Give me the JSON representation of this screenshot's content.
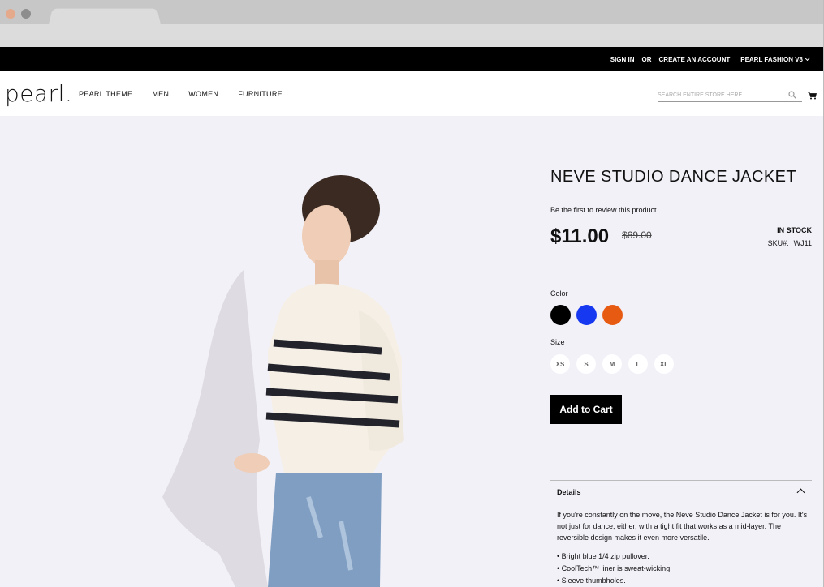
{
  "topbar": {
    "sign_in": "SIGN IN",
    "or": "OR",
    "create_account": "CREATE AN ACCOUNT",
    "store_switcher": "PEARL FASHION V8"
  },
  "header": {
    "logo": "pearl.",
    "nav": [
      "PEARL THEME",
      "MEN",
      "WOMEN",
      "FURNITURE"
    ],
    "search_placeholder": "SEARCH ENTIRE STORE HERE..."
  },
  "product": {
    "title": "NEVE STUDIO DANCE JACKET",
    "review_link": "Be the first to review this product",
    "price": "$11.00",
    "old_price": "$69.00",
    "stock": "IN STOCK",
    "sku_label": "SKU#:",
    "sku_value": "WJ11",
    "color_label": "Color",
    "colors": [
      "#000000",
      "#1638f0",
      "#e75a12"
    ],
    "size_label": "Size",
    "sizes": [
      "XS",
      "S",
      "M",
      "L",
      "XL"
    ],
    "add_to_cart": "Add to Cart",
    "details_heading": "Details",
    "details_text": "If you're constantly on the move, the Neve Studio Dance Jacket is for you. It's not just for dance, either, with a tight fit that works as a mid-layer. The reversible design makes it even more versatile.",
    "bullets": [
      "• Bright blue 1/4 zip pullover.",
      "• CoolTech™ liner is sweat-wicking.",
      "• Sleeve thumbholes."
    ]
  }
}
